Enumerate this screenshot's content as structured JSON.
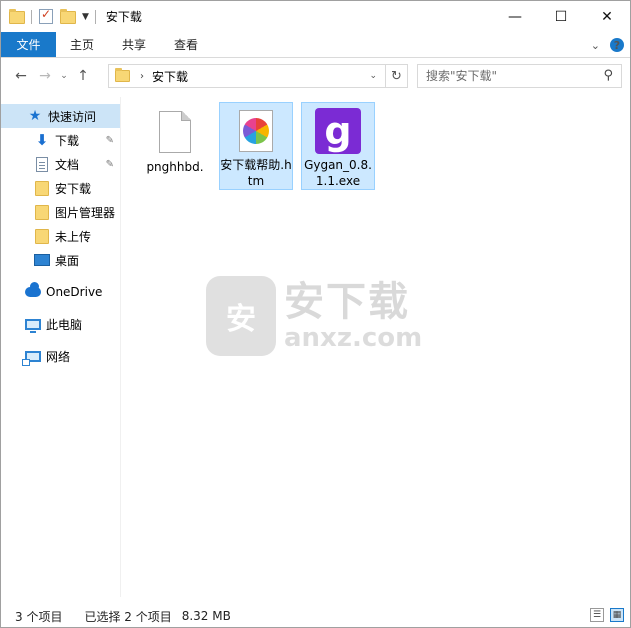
{
  "window": {
    "title": "安下载",
    "controls": {
      "minimize": "—",
      "maximize": "☐",
      "close": "✕"
    }
  },
  "ribbon": {
    "tabs": [
      "文件",
      "主页",
      "共享",
      "查看"
    ],
    "collapse_glyph": "⌄",
    "help_glyph": "?"
  },
  "nav": {
    "back": "←",
    "forward": "→",
    "recent": "⌄",
    "up": "↑"
  },
  "address": {
    "crumb_separator": "›",
    "path": "安下载",
    "dropdown": "⌄",
    "refresh": "↻"
  },
  "search": {
    "placeholder": "搜索\"安下载\"",
    "icon": "search-icon"
  },
  "sidebar": {
    "items": [
      {
        "label": "快速访问",
        "icon": "star-icon",
        "selected": true,
        "pinned": false
      },
      {
        "label": "下载",
        "icon": "download-arrow-icon",
        "pinned": true
      },
      {
        "label": "文档",
        "icon": "document-icon",
        "pinned": true
      },
      {
        "label": "安下载",
        "icon": "folder-icon"
      },
      {
        "label": "图片管理器",
        "icon": "folder-icon"
      },
      {
        "label": "未上传",
        "icon": "folder-icon"
      },
      {
        "label": "桌面",
        "icon": "desktop-icon"
      },
      {
        "label": "OneDrive",
        "icon": "cloud-icon"
      },
      {
        "label": "此电脑",
        "icon": "computer-icon"
      },
      {
        "label": "网络",
        "icon": "network-icon"
      }
    ],
    "pin_glyph": "📌"
  },
  "files": [
    {
      "name": "pnghhbd.",
      "icon": "blank-file-icon",
      "selected": false
    },
    {
      "name": "安下载帮助.htm",
      "icon": "htm-pinwheel-icon",
      "selected": true
    },
    {
      "name": "Gygan_0.8.1.1.exe",
      "icon": "gygan-exe-icon",
      "selected": true,
      "glyph": "g"
    }
  ],
  "watermark": {
    "shield_text": "安",
    "cn": "安下载",
    "en": "anxz.com"
  },
  "status": {
    "item_count": "3 个项目",
    "selected_count": "已选择 2 个项目",
    "selected_size": "8.32 MB"
  },
  "colors": {
    "file_tab": "#1979ca",
    "selection": "#cce8ff",
    "nav_selected": "#cce4f7",
    "exe_icon": "#7b2bd4"
  }
}
